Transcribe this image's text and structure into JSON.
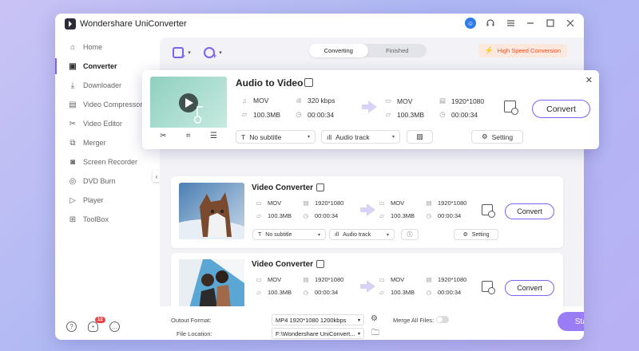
{
  "app": {
    "title": "Wondershare UniConverter"
  },
  "titlebar": {
    "avatar_letter": "☺"
  },
  "sidebar": {
    "items": [
      {
        "label": "Home",
        "icon": "home-icon"
      },
      {
        "label": "Converter",
        "icon": "converter-icon",
        "active": true
      },
      {
        "label": "Downloader",
        "icon": "downloader-icon"
      },
      {
        "label": "Video Compressor",
        "icon": "compress-icon"
      },
      {
        "label": "Video Editor",
        "icon": "scissors-icon"
      },
      {
        "label": "Merger",
        "icon": "merge-icon"
      },
      {
        "label": "Screen Recorder",
        "icon": "record-icon"
      },
      {
        "label": "DVD Burn",
        "icon": "disc-icon"
      },
      {
        "label": "Player",
        "icon": "play-icon"
      },
      {
        "label": "ToolBox",
        "icon": "grid-icon"
      }
    ],
    "notification_count": "12"
  },
  "toolbar": {
    "tabs": [
      "Converting",
      "Finished"
    ],
    "active_tab": "Converting",
    "high_speed": "High Speed Conversion"
  },
  "popup": {
    "title": "Audio to Video",
    "src_format": "MOV",
    "src_bitrate": "320 kbps",
    "src_size": "100.3MB",
    "src_duration": "00:00:34",
    "dst_format": "MOV",
    "dst_resolution": "1920*1080",
    "dst_size": "100.3MB",
    "dst_duration": "00:00:34",
    "convert": "Convert",
    "subtitle": "No subtitle",
    "audio": "Audio track",
    "setting": "Setting"
  },
  "files": [
    {
      "title": "Video Converter",
      "src_format": "MOV",
      "src_resolution": "1920*1080",
      "src_size": "100.3MB",
      "src_duration": "00:00:34",
      "dst_format": "MOV",
      "dst_resolution": "1920*1080",
      "dst_size": "100.3MB",
      "dst_duration": "00:00:34",
      "convert": "Convert",
      "subtitle": "No subtitle",
      "audio": "Audio track",
      "setting": "Setting"
    },
    {
      "title": "Video Converter",
      "src_format": "MOV",
      "src_resolution": "1920*1080",
      "src_size": "100.3MB",
      "src_duration": "00:00:34",
      "dst_format": "MOV",
      "dst_resolution": "1920*1080",
      "dst_size": "100.3MB",
      "dst_duration": "00:00:34",
      "convert": "Convert"
    }
  ],
  "footer": {
    "output_format_label": "Outout Format:",
    "output_format_value": "MP4 1920*1080 1200kbps",
    "merge_label": "Merge All Files:",
    "file_location_label": "File Location:",
    "file_location_value": "F:\\Wondershare UniConvert...",
    "start_all": "Start All"
  },
  "colors": {
    "accent": "#7b62f2",
    "start_button": "#9a7df5",
    "high_speed": "#e5502b"
  }
}
